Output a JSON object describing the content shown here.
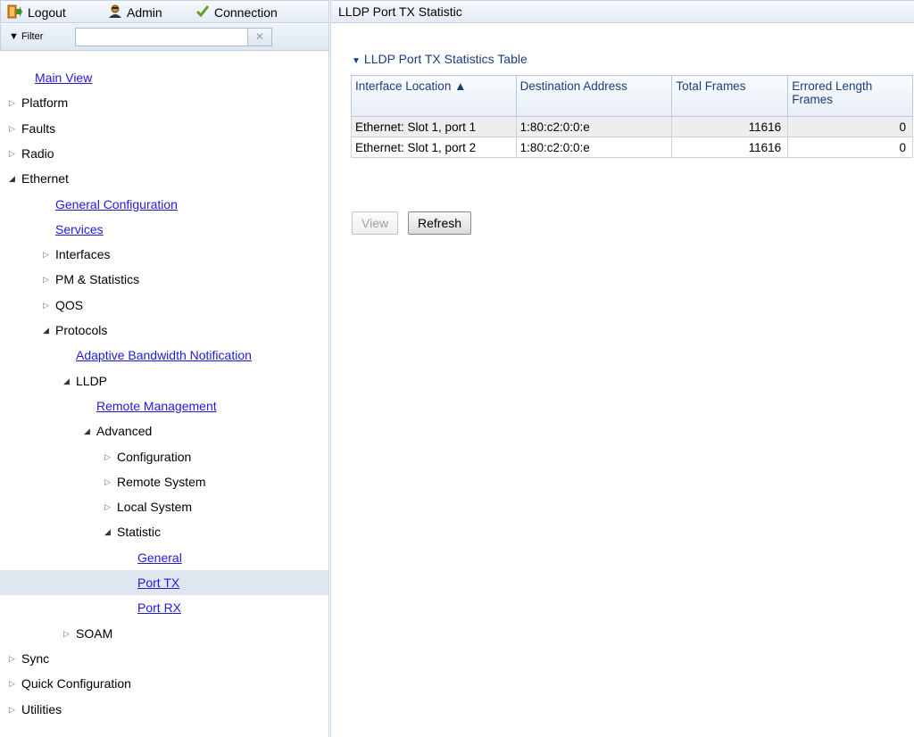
{
  "topbar": {
    "logout": "Logout",
    "admin": "Admin",
    "connection": "Connection"
  },
  "filter": {
    "label": "▼ Filter",
    "value": "",
    "clear": "✕"
  },
  "tree": [
    {
      "label": "Main View",
      "link": true,
      "depth": 0,
      "arrow": ""
    },
    {
      "label": "Platform",
      "link": false,
      "depth": 0,
      "arrow": "closed"
    },
    {
      "label": "Faults",
      "link": false,
      "depth": 0,
      "arrow": "closed"
    },
    {
      "label": "Radio",
      "link": false,
      "depth": 0,
      "arrow": "closed"
    },
    {
      "label": "Ethernet",
      "link": false,
      "depth": 0,
      "arrow": "open"
    },
    {
      "label": "General Configuration",
      "link": true,
      "depth": 1,
      "arrow": ""
    },
    {
      "label": "Services",
      "link": true,
      "depth": 1,
      "arrow": ""
    },
    {
      "label": "Interfaces",
      "link": false,
      "depth": 1,
      "arrow": "closed"
    },
    {
      "label": "PM & Statistics",
      "link": false,
      "depth": 1,
      "arrow": "closed"
    },
    {
      "label": "QOS",
      "link": false,
      "depth": 1,
      "arrow": "closed"
    },
    {
      "label": "Protocols",
      "link": false,
      "depth": 1,
      "arrow": "open"
    },
    {
      "label": "Adaptive Bandwidth Notification",
      "link": true,
      "depth": 2,
      "arrow": ""
    },
    {
      "label": "LLDP",
      "link": false,
      "depth": 2,
      "arrow": "open"
    },
    {
      "label": "Remote Management",
      "link": true,
      "depth": 3,
      "arrow": ""
    },
    {
      "label": "Advanced",
      "link": false,
      "depth": 3,
      "arrow": "open"
    },
    {
      "label": "Configuration",
      "link": false,
      "depth": 4,
      "arrow": "closed"
    },
    {
      "label": "Remote System",
      "link": false,
      "depth": 4,
      "arrow": "closed"
    },
    {
      "label": "Local System",
      "link": false,
      "depth": 4,
      "arrow": "closed"
    },
    {
      "label": "Statistic",
      "link": false,
      "depth": 4,
      "arrow": "open"
    },
    {
      "label": "General",
      "link": true,
      "depth": 5,
      "arrow": ""
    },
    {
      "label": "Port TX",
      "link": true,
      "depth": 5,
      "arrow": "",
      "selected": true
    },
    {
      "label": "Port RX",
      "link": true,
      "depth": 5,
      "arrow": ""
    },
    {
      "label": "SOAM",
      "link": false,
      "depth": 2,
      "arrow": "closed"
    },
    {
      "label": "Sync",
      "link": false,
      "depth": 0,
      "arrow": "closed"
    },
    {
      "label": "Quick Configuration",
      "link": false,
      "depth": 0,
      "arrow": "closed"
    },
    {
      "label": "Utilities",
      "link": false,
      "depth": 0,
      "arrow": "closed"
    }
  ],
  "main": {
    "title": "LLDP Port TX Statistic",
    "section_title": "LLDP Port TX Statistics Table",
    "table": {
      "headers": [
        "Interface Location ▲",
        "Destination Address",
        "Total Frames",
        "Errored Length Frames"
      ],
      "rows": [
        [
          "Ethernet: Slot 1, port 1",
          "1:80:c2:0:0:e",
          "11616",
          "0"
        ],
        [
          "Ethernet: Slot 1, port 2",
          "1:80:c2:0:0:e",
          "11616",
          "0"
        ]
      ]
    },
    "buttons": {
      "view": "View",
      "refresh": "Refresh"
    }
  },
  "colors": {
    "link": "#1f1ad9",
    "header_text": "#1a3d80",
    "selected_row": "#e0e6ef",
    "panel_border": "#c1d1e3"
  }
}
